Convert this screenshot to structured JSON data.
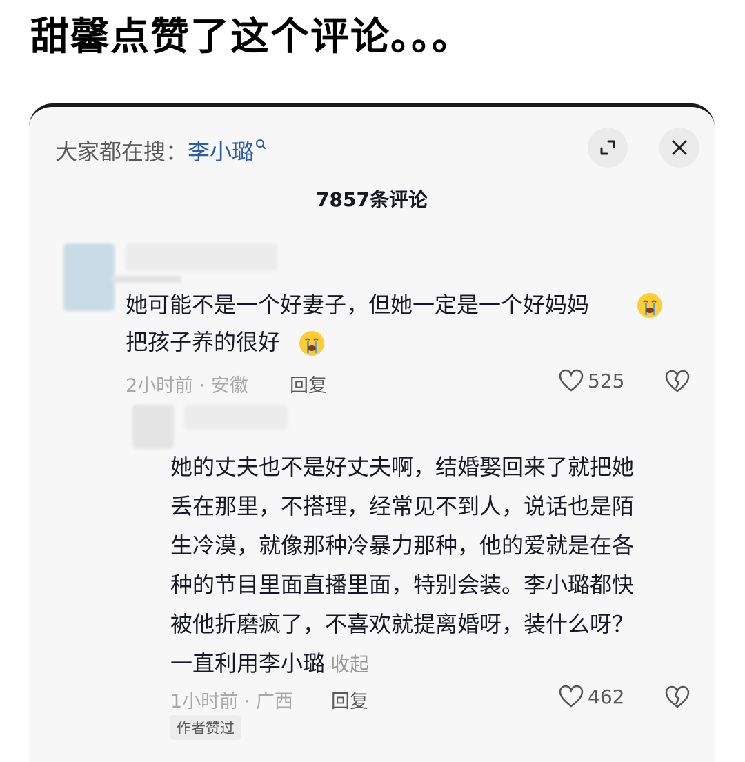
{
  "headline": "甜馨点赞了这个评论。。。",
  "search": {
    "prefix": "大家都在搜：",
    "term": "李小璐"
  },
  "comment_count": "7857条评论",
  "comments": [
    {
      "text": "她可能不是一个好妻子，但她一定是一个好妈妈\n把孩子养的很好",
      "emoji": "crying-face",
      "time_location": "2小时前 · 安徽",
      "reply_label": "回复",
      "likes": "525"
    },
    {
      "text": "她的丈夫也不是好丈夫啊，结婚娶回来了就把她\n丢在那里，不搭理，经常见不到人，说话也是陌\n生冷漠，就像那种冷暴力那种，他的爱就是在各\n种的节目里面直播里面，特别会装。李小璐都快\n被他折磨疯了，不喜欢就提离婚呀，装什么呀？\n一直利用李小璐",
      "collapse_label": "收起",
      "time_location": "1小时前 · 广西",
      "reply_label": "回复",
      "likes": "462",
      "badge": "作者赞过"
    }
  ],
  "colors": {
    "search_term": "#2a5ca8",
    "text_primary": "#161823",
    "text_secondary": "#a8a8a8",
    "card_bg": "#f7f7f7",
    "emoji_yellow": "#ffcc33",
    "tear_blue": "#4aa8e8"
  },
  "icons": [
    "search-mini-icon",
    "expand-icon",
    "close-icon",
    "heart-icon",
    "broken-heart-icon",
    "crying-emoji-icon"
  ]
}
